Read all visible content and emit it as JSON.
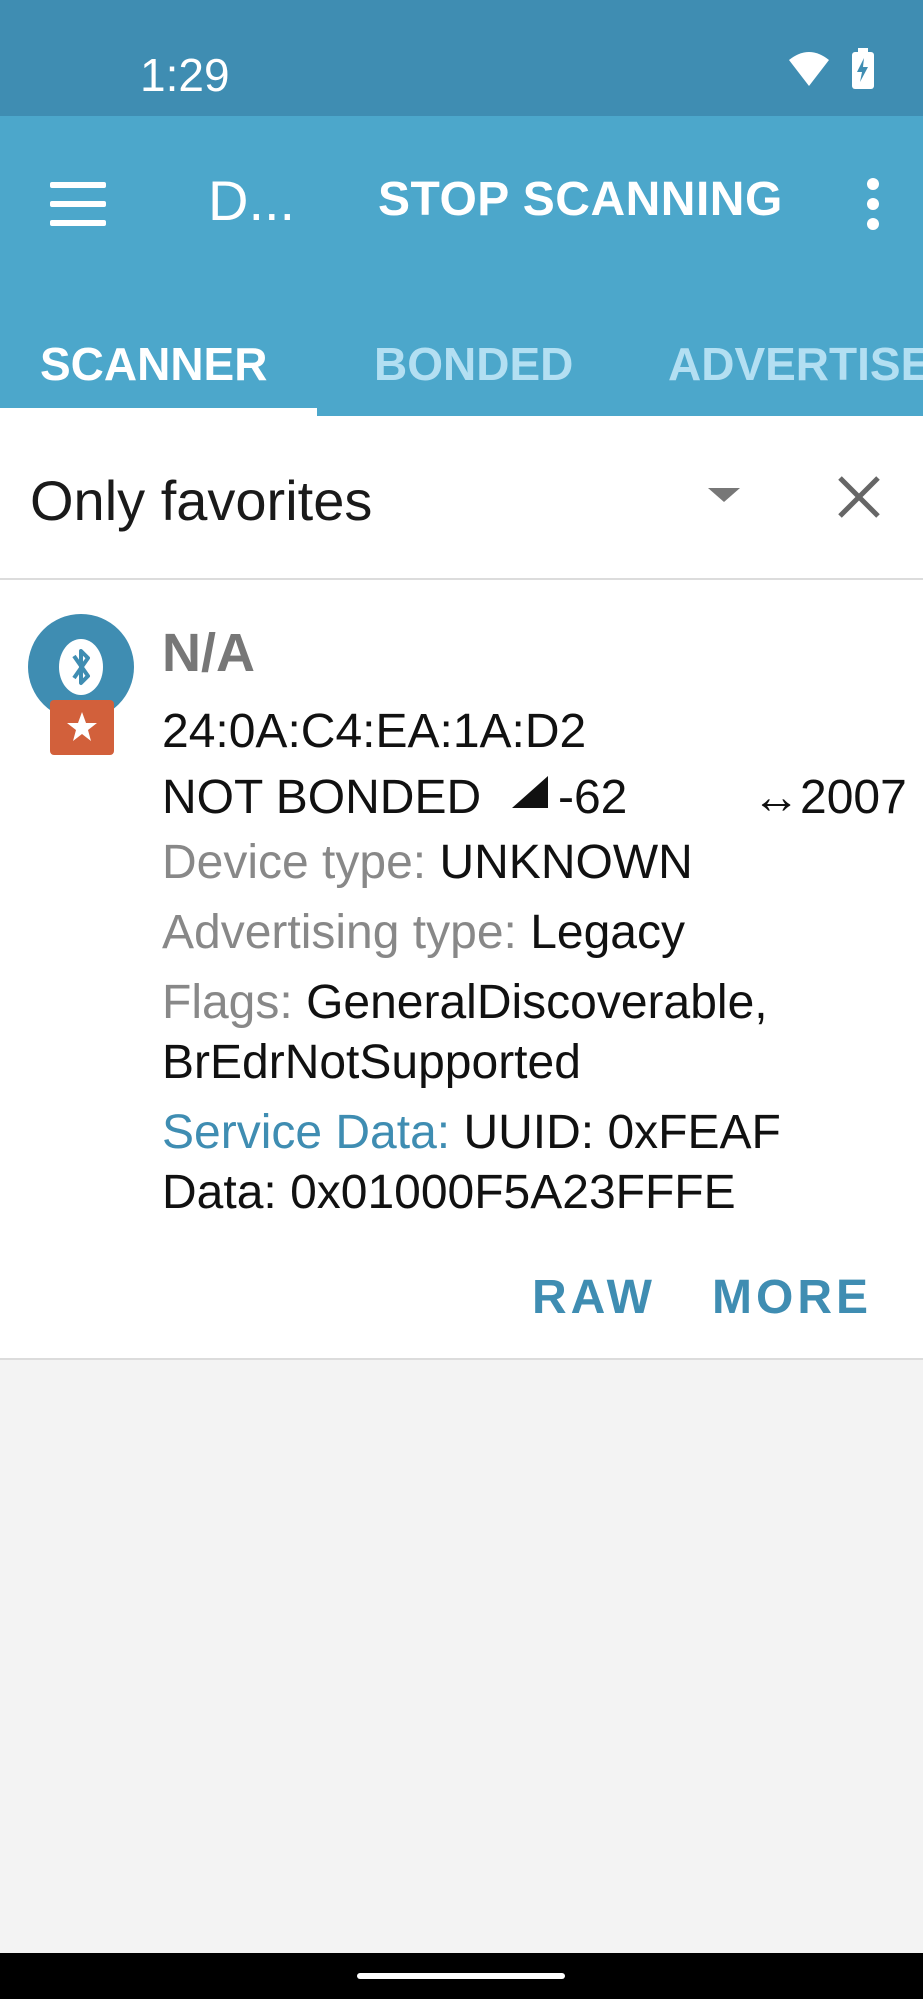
{
  "status_bar": {
    "time": "1:29"
  },
  "app_bar": {
    "title": "D...",
    "stop_scanning_label": "STOP SCANNING"
  },
  "tabs": [
    {
      "label": "SCANNER",
      "active": true
    },
    {
      "label": "BONDED",
      "active": false
    },
    {
      "label": "ADVERTISER",
      "active": false
    }
  ],
  "filter": {
    "label": "Only favorites"
  },
  "device": {
    "name": "N/A",
    "address": "24:0A:C4:EA:1A:D2",
    "bond_state": "NOT BONDED",
    "rssi": "-62",
    "interval": "2007",
    "device_type_label": "Device type:",
    "device_type_value": "UNKNOWN",
    "adv_type_label": "Advertising type:",
    "adv_type_value": "Legacy",
    "flags_label": "Flags:",
    "flags_value_1": "GeneralDiscoverable,",
    "flags_value_2": "BrEdrNotSupported",
    "service_data_label": "Service Data:",
    "service_data_uuid": "UUID: 0xFEAF",
    "service_data_data": "Data: 0x01000F5A23FFFE",
    "raw_label": "RAW",
    "more_label": "MORE"
  },
  "colors": {
    "status_bar": "#3f8db2",
    "app_bar": "#4ca7cb",
    "accent": "#3f8db2",
    "favorite": "#d2603b"
  }
}
